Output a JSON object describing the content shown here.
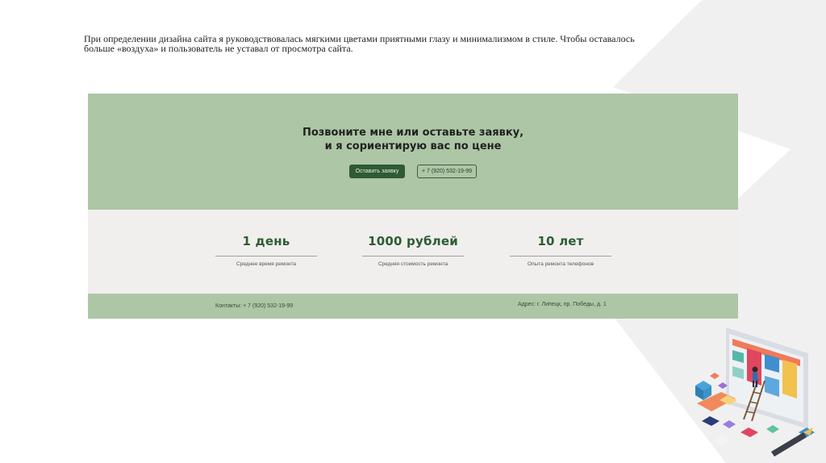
{
  "slide": {
    "intro_line1": "При определении дизайна сайта я руководствовалась мягкими цветами приятными глазу и минимализмом в стиле. Чтобы оставалось",
    "intro_line2": "больше «воздуха» и пользователь не уставал от просмотра сайта."
  },
  "hero": {
    "title_line1": "Позвоните мне или оставьте заявку,",
    "title_line2": "и я сориентирую вас по цене",
    "request_button": "Оставить заявку",
    "phone_button": "+ 7 (920) 532-19-99"
  },
  "stats": [
    {
      "value": "1 день",
      "caption": "Среднее время ремонта"
    },
    {
      "value": "1000 рублей",
      "caption": "Средняя стоимость ремонта"
    },
    {
      "value": "10 лет",
      "caption": "Опыта ремонта телефонов"
    }
  ],
  "footer": {
    "contacts": "Контакты: + 7 (920) 532-19-99",
    "address": "Адрес: г. Липецк, пр. Победы, д. 1"
  },
  "colors": {
    "sage": "#adc6a5",
    "dark_green": "#2f5a33",
    "stats_bg": "#f1efee"
  }
}
